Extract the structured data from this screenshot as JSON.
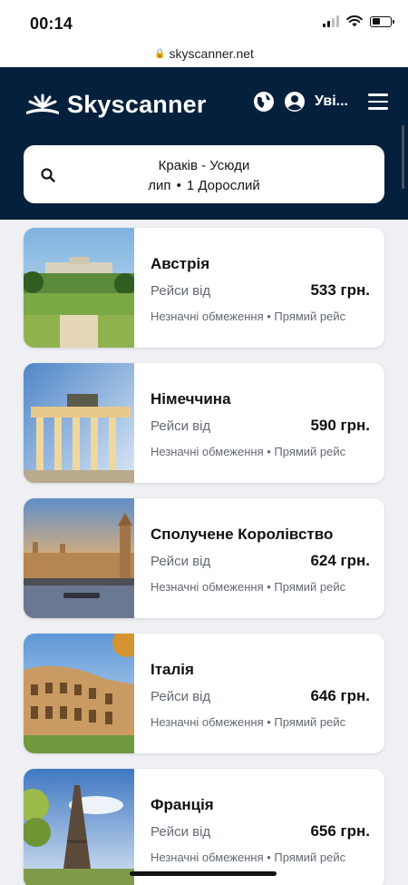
{
  "status_bar": {
    "time": "00:14"
  },
  "browser": {
    "url": "skyscanner.net"
  },
  "header": {
    "brand": "Skyscanner",
    "login_label": "Уві...",
    "search": {
      "route": "Краків - Усюди",
      "month": "лип",
      "travellers": "1 Дорослий"
    }
  },
  "results": [
    {
      "country": "Австрія",
      "flights_from": "Рейси від",
      "price": "533 грн.",
      "restrictions": "Незначні обмеження",
      "flight_type": "Прямий рейс"
    },
    {
      "country": "Німеччина",
      "flights_from": "Рейси від",
      "price": "590 грн.",
      "restrictions": "Незначні обмеження",
      "flight_type": "Прямий рейс"
    },
    {
      "country": "Сполучене Королівство",
      "flights_from": "Рейси від",
      "price": "624 грн.",
      "restrictions": "Незначні обмеження",
      "flight_type": "Прямий рейс"
    },
    {
      "country": "Італія",
      "flights_from": "Рейси від",
      "price": "646 грн.",
      "restrictions": "Незначні обмеження",
      "flight_type": "Прямий рейс"
    },
    {
      "country": "Франція",
      "flights_from": "Рейси від",
      "price": "656 грн.",
      "restrictions": "Незначні обмеження",
      "flight_type": "Прямий рейс"
    }
  ],
  "colors": {
    "header_bg": "#05203c",
    "page_bg": "#eef0f3",
    "text_muted": "#626971"
  },
  "icons": [
    "signal-icon",
    "wifi-icon",
    "battery-icon",
    "lock-icon",
    "skyscanner-logo",
    "globe-icon",
    "user-icon",
    "hamburger-menu-icon",
    "search-icon"
  ]
}
